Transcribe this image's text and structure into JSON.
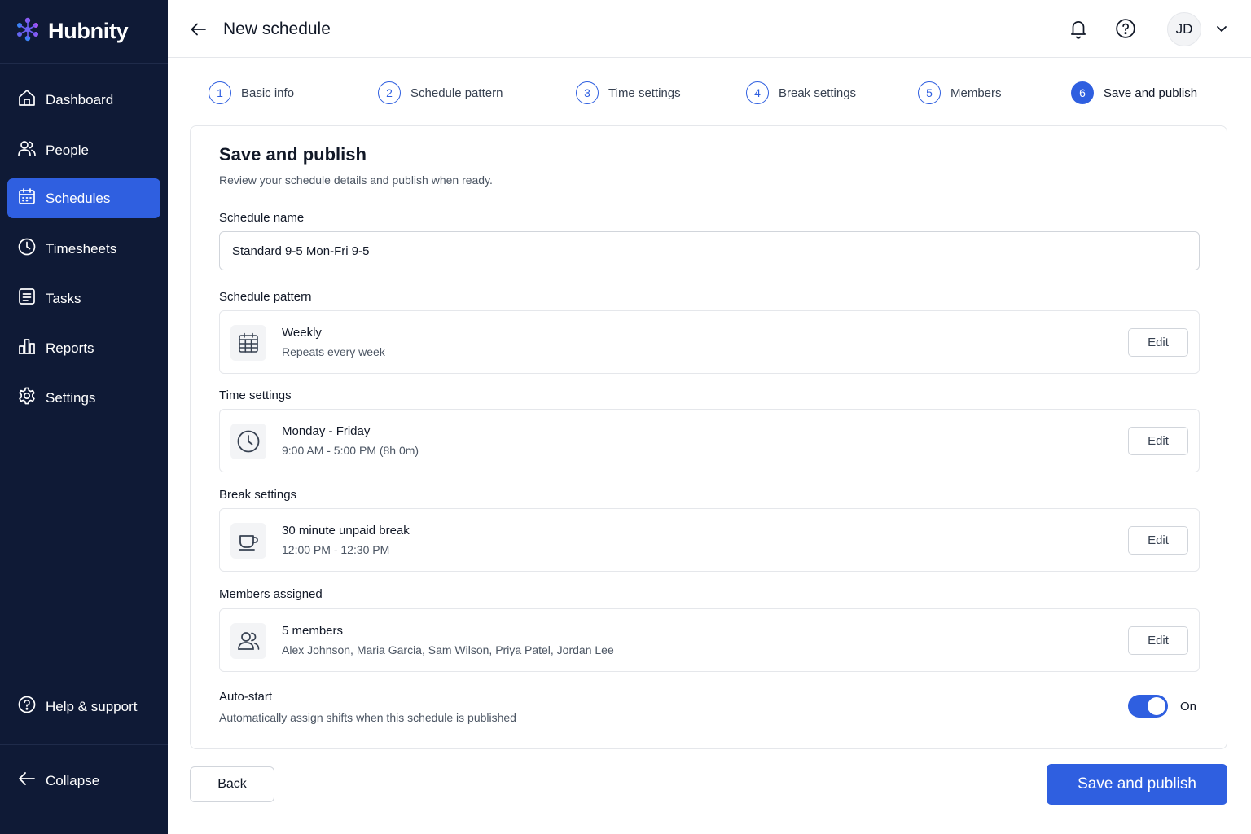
{
  "app": {
    "name": "Hubnity",
    "logo_icon": "hubnity-logo-icon"
  },
  "colors": {
    "sidebar_bg": "#0f1a36",
    "accent": "#2f5fe0",
    "border": "#e5e7eb",
    "muted_text": "#4b5563"
  },
  "sidebar": {
    "items": [
      {
        "label": "Dashboard",
        "icon": "home-icon",
        "active": false
      },
      {
        "label": "People",
        "icon": "people-icon",
        "active": false
      },
      {
        "label": "Schedules",
        "icon": "calendar-icon",
        "active": true
      },
      {
        "label": "Timesheets",
        "icon": "clock-icon",
        "active": false
      },
      {
        "label": "Tasks",
        "icon": "tasks-icon",
        "active": false
      },
      {
        "label": "Reports",
        "icon": "reports-icon",
        "active": false
      },
      {
        "label": "Settings",
        "icon": "gear-icon",
        "active": false
      }
    ],
    "help_label": "Help & support",
    "collapse_label": "Collapse"
  },
  "header": {
    "title": "New schedule",
    "user_initials": "JD"
  },
  "stepper": {
    "current": 6,
    "steps": [
      {
        "number": "1",
        "label": "Basic info"
      },
      {
        "number": "2",
        "label": "Schedule pattern"
      },
      {
        "number": "3",
        "label": "Time settings"
      },
      {
        "number": "4",
        "label": "Break settings"
      },
      {
        "number": "5",
        "label": "Members"
      },
      {
        "number": "6",
        "label": "Save and publish"
      }
    ]
  },
  "main": {
    "title": "Save and publish",
    "subtitle": "Review your schedule details and publish when ready.",
    "schedule_name_label": "Schedule name",
    "schedule_name_value": "Standard 9-5 Mon-Fri 9-5",
    "edit_label": "Edit",
    "sections": [
      {
        "label": "Schedule pattern",
        "icon": "calendar-grid-icon",
        "title": "Weekly",
        "subtitle": "Repeats every week"
      },
      {
        "label": "Time settings",
        "icon": "clock-icon",
        "title": "Monday - Friday",
        "subtitle": "9:00 AM - 5:00 PM (8h 0m)"
      },
      {
        "label": "Break settings",
        "icon": "coffee-cup-icon",
        "title": "30 minute unpaid break",
        "subtitle": "12:00 PM - 12:30 PM"
      },
      {
        "label": "Members assigned",
        "icon": "members-icon",
        "title": "5 members",
        "subtitle": "Alex Johnson, Maria Garcia, Sam Wilson, Priya Patel, Jordan Lee"
      }
    ],
    "autostart": {
      "title": "Auto-start",
      "subtitle": "Automatically assign shifts when this schedule is published",
      "enabled": true,
      "state_label": "On"
    }
  },
  "footer": {
    "back_label": "Back",
    "primary_label": "Save and publish"
  }
}
